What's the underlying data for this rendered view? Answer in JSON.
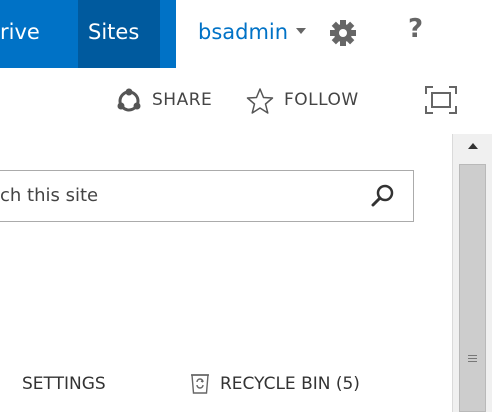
{
  "top_nav": {
    "onedrive_tab_partial": "rive",
    "sites_tab": "Sites",
    "user_name": "bsadmin",
    "help_label": "?"
  },
  "page_actions": {
    "share_label": "SHARE",
    "follow_label": "FOLLOW"
  },
  "search": {
    "placeholder_partial": "ch this site"
  },
  "quick_links": {
    "settings_partial": "SETTINGS",
    "recycle_bin_label": "RECYCLE BIN (5)"
  },
  "icons": {
    "gear": "gear-icon",
    "share": "share-icon",
    "follow": "star-icon",
    "focus": "focus-on-content-icon",
    "search": "search-icon",
    "recycle": "recycle-bin-icon"
  },
  "colors": {
    "suite_bar": "#0072c6",
    "selected_tab": "#005a9e",
    "user_name": "#0072c6",
    "scrollbar_track": "#f0f0f0",
    "scrollbar_thumb": "#cdcdcd"
  }
}
